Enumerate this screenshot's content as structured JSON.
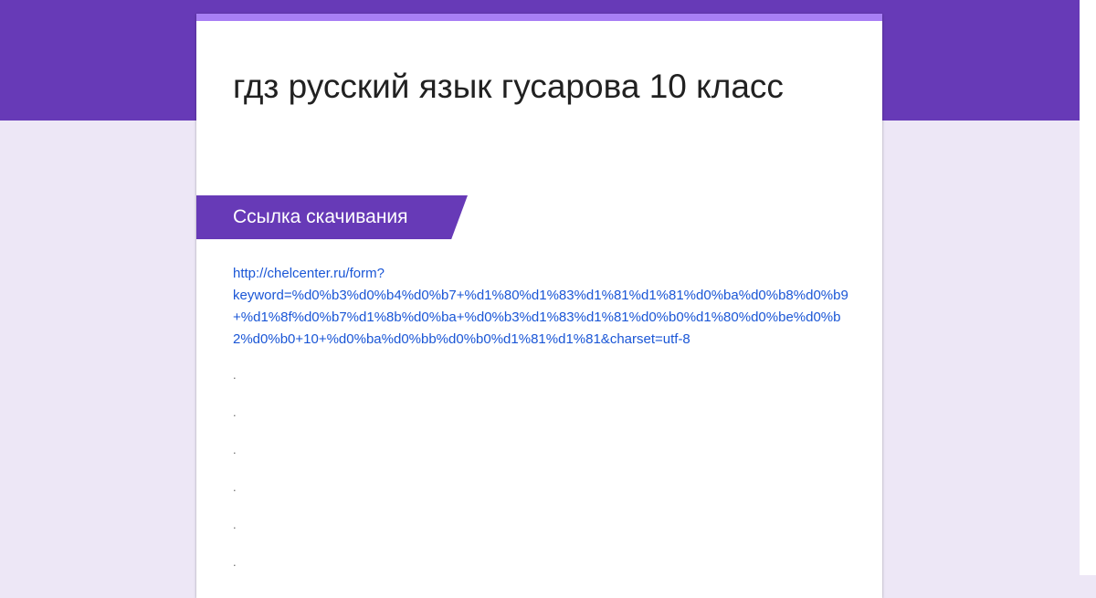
{
  "form": {
    "title": "гдз русский язык гусарова 10 класс",
    "section_title": "Ссылка скачивания",
    "link_line1": "http://chelcenter.ru/form?",
    "link_line2": "keyword=%d0%b3%d0%b4%d0%b7+%d1%80%d1%83%d1%81%d1%81%d0%ba%d0%b8%d0%b9+%d1%8f%d0%b7%d1%8b%d0%ba+%d0%b3%d1%83%d1%81%d0%b0%d1%80%d0%be%d0%b2%d0%b0+10+%d0%ba%d0%bb%d0%b0%d1%81%d1%81&charset=utf-8",
    "dots": [
      ".",
      ".",
      ".",
      ".",
      ".",
      "."
    ]
  },
  "colors": {
    "brand": "#673ab7",
    "accent": "#a87ff5",
    "background": "#ede7f6",
    "link": "#1a56d6"
  }
}
